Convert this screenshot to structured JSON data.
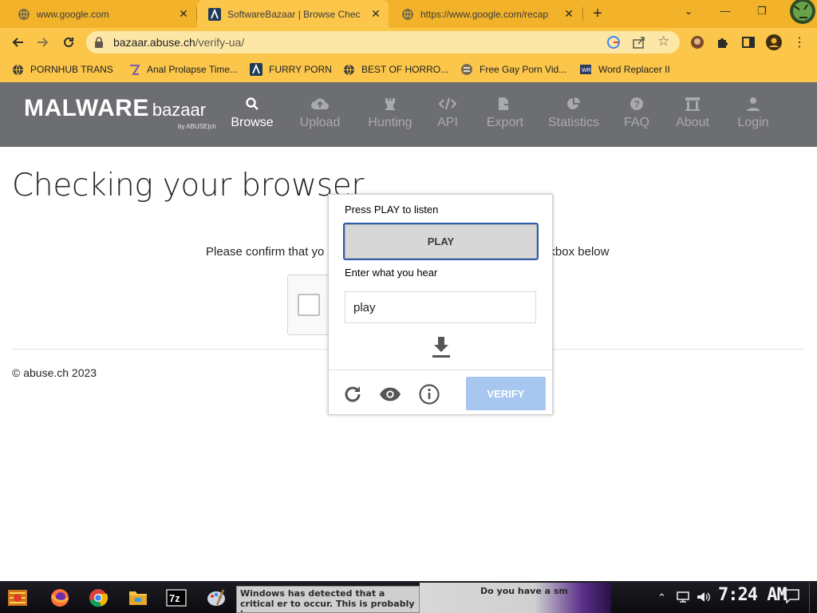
{
  "browser": {
    "tabs": [
      {
        "title": "www.google.com",
        "icon": "globe-icon"
      },
      {
        "title": "SoftwareBazaar | Browse Chec",
        "icon": "bazaar-icon"
      },
      {
        "title": "https://www.google.com/recap",
        "icon": "globe-icon"
      }
    ],
    "url_host": "bazaar.abuse.ch",
    "url_path": "/verify-ua/",
    "bookmarks": [
      {
        "label": "PORNHUB TRANS",
        "icon": "globe-icon"
      },
      {
        "label": "Anal Prolapse Time...",
        "icon": "bookmark-icon"
      },
      {
        "label": "FURRY PORN",
        "icon": "bazaar-icon"
      },
      {
        "label": "BEST OF HORRO...",
        "icon": "globe-icon"
      },
      {
        "label": "Free Gay Porn Vid...",
        "icon": "bookmark-icon"
      },
      {
        "label": "Word Replacer II",
        "icon": "extension-icon"
      }
    ]
  },
  "site": {
    "logo_main": "MALWARE",
    "logo_sub": "bazaar",
    "logo_by": "by ABUSE|ch",
    "nav": [
      {
        "label": "Browse",
        "icon": "search-icon",
        "active": true
      },
      {
        "label": "Upload",
        "icon": "cloud-upload-icon",
        "active": false
      },
      {
        "label": "Hunting",
        "icon": "chess-rook-icon",
        "active": false
      },
      {
        "label": "API",
        "icon": "code-icon",
        "active": false
      },
      {
        "label": "Export",
        "icon": "file-export-icon",
        "active": false
      },
      {
        "label": "Statistics",
        "icon": "pie-chart-icon",
        "active": false
      },
      {
        "label": "FAQ",
        "icon": "question-icon",
        "active": false
      },
      {
        "label": "About",
        "icon": "building-icon",
        "active": false
      },
      {
        "label": "Login",
        "icon": "user-icon",
        "active": false
      }
    ]
  },
  "page": {
    "title": "Checking your browser",
    "confirm_text": "Please confirm that yo",
    "confirm_text_tail": "kbox below",
    "footer": "© abuse.ch 2023"
  },
  "captcha": {
    "press_label": "Press PLAY to listen",
    "play_label": "PLAY",
    "enter_label": "Enter what you hear",
    "answer_value": "play",
    "verify_label": "VERIFY"
  },
  "taskbar": {
    "popup_a": "Windows has detected that a critical er to occur. This is probably because you",
    "popup_b": "Do you have a sm",
    "clock": "7:24 AM"
  },
  "colors": {
    "tab_bar": "#f2b32b",
    "toolbar": "#fbc64a",
    "site_header": "#6d6e71",
    "verify_button": "#a8c7f0",
    "play_border": "#2a5ca8"
  }
}
